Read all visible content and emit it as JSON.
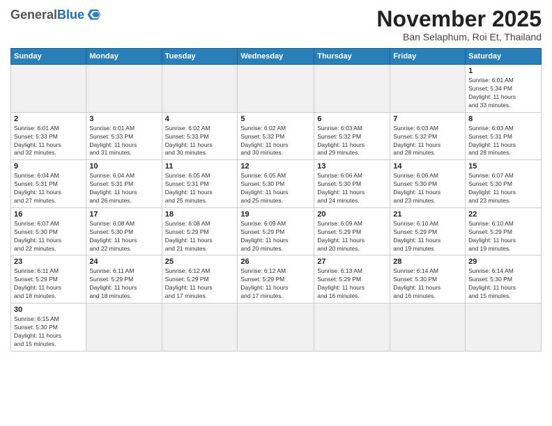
{
  "header": {
    "logo_general": "General",
    "logo_blue": "Blue",
    "month_title": "November 2025",
    "subtitle": "Ban Selaphum, Roi Et, Thailand"
  },
  "weekdays": [
    "Sunday",
    "Monday",
    "Tuesday",
    "Wednesday",
    "Thursday",
    "Friday",
    "Saturday"
  ],
  "days": [
    {
      "num": "",
      "info": ""
    },
    {
      "num": "",
      "info": ""
    },
    {
      "num": "",
      "info": ""
    },
    {
      "num": "",
      "info": ""
    },
    {
      "num": "",
      "info": ""
    },
    {
      "num": "",
      "info": ""
    },
    {
      "num": "1",
      "info": "Sunrise: 6:01 AM\nSunset: 5:34 PM\nDaylight: 11 hours\nand 33 minutes."
    },
    {
      "num": "2",
      "info": "Sunrise: 6:01 AM\nSunset: 5:33 PM\nDaylight: 11 hours\nand 32 minutes."
    },
    {
      "num": "3",
      "info": "Sunrise: 6:01 AM\nSunset: 5:33 PM\nDaylight: 11 hours\nand 31 minutes."
    },
    {
      "num": "4",
      "info": "Sunrise: 6:02 AM\nSunset: 5:33 PM\nDaylight: 11 hours\nand 30 minutes."
    },
    {
      "num": "5",
      "info": "Sunrise: 6:02 AM\nSunset: 5:32 PM\nDaylight: 11 hours\nand 30 minutes."
    },
    {
      "num": "6",
      "info": "Sunrise: 6:03 AM\nSunset: 5:32 PM\nDaylight: 11 hours\nand 29 minutes."
    },
    {
      "num": "7",
      "info": "Sunrise: 6:03 AM\nSunset: 5:32 PM\nDaylight: 11 hours\nand 28 minutes."
    },
    {
      "num": "8",
      "info": "Sunrise: 6:03 AM\nSunset: 5:31 PM\nDaylight: 11 hours\nand 28 minutes."
    },
    {
      "num": "9",
      "info": "Sunrise: 6:04 AM\nSunset: 5:31 PM\nDaylight: 11 hours\nand 27 minutes."
    },
    {
      "num": "10",
      "info": "Sunrise: 6:04 AM\nSunset: 5:31 PM\nDaylight: 11 hours\nand 26 minutes."
    },
    {
      "num": "11",
      "info": "Sunrise: 6:05 AM\nSunset: 5:31 PM\nDaylight: 11 hours\nand 25 minutes."
    },
    {
      "num": "12",
      "info": "Sunrise: 6:05 AM\nSunset: 5:30 PM\nDaylight: 11 hours\nand 25 minutes."
    },
    {
      "num": "13",
      "info": "Sunrise: 6:06 AM\nSunset: 5:30 PM\nDaylight: 11 hours\nand 24 minutes."
    },
    {
      "num": "14",
      "info": "Sunrise: 6:06 AM\nSunset: 5:30 PM\nDaylight: 11 hours\nand 23 minutes."
    },
    {
      "num": "15",
      "info": "Sunrise: 6:07 AM\nSunset: 5:30 PM\nDaylight: 11 hours\nand 23 minutes."
    },
    {
      "num": "16",
      "info": "Sunrise: 6:07 AM\nSunset: 5:30 PM\nDaylight: 11 hours\nand 22 minutes."
    },
    {
      "num": "17",
      "info": "Sunrise: 6:08 AM\nSunset: 5:30 PM\nDaylight: 11 hours\nand 22 minutes."
    },
    {
      "num": "18",
      "info": "Sunrise: 6:08 AM\nSunset: 5:29 PM\nDaylight: 11 hours\nand 21 minutes."
    },
    {
      "num": "19",
      "info": "Sunrise: 6:09 AM\nSunset: 5:29 PM\nDaylight: 11 hours\nand 20 minutes."
    },
    {
      "num": "20",
      "info": "Sunrise: 6:09 AM\nSunset: 5:29 PM\nDaylight: 11 hours\nand 20 minutes."
    },
    {
      "num": "21",
      "info": "Sunrise: 6:10 AM\nSunset: 5:29 PM\nDaylight: 11 hours\nand 19 minutes."
    },
    {
      "num": "22",
      "info": "Sunrise: 6:10 AM\nSunset: 5:29 PM\nDaylight: 11 hours\nand 19 minutes."
    },
    {
      "num": "23",
      "info": "Sunrise: 6:11 AM\nSunset: 5:29 PM\nDaylight: 11 hours\nand 18 minutes."
    },
    {
      "num": "24",
      "info": "Sunrise: 6:11 AM\nSunset: 5:29 PM\nDaylight: 11 hours\nand 18 minutes."
    },
    {
      "num": "25",
      "info": "Sunrise: 6:12 AM\nSunset: 5:29 PM\nDaylight: 11 hours\nand 17 minutes."
    },
    {
      "num": "26",
      "info": "Sunrise: 6:12 AM\nSunset: 5:29 PM\nDaylight: 11 hours\nand 17 minutes."
    },
    {
      "num": "27",
      "info": "Sunrise: 6:13 AM\nSunset: 5:29 PM\nDaylight: 11 hours\nand 16 minutes."
    },
    {
      "num": "28",
      "info": "Sunrise: 6:14 AM\nSunset: 5:30 PM\nDaylight: 11 hours\nand 16 minutes."
    },
    {
      "num": "29",
      "info": "Sunrise: 6:14 AM\nSunset: 5:30 PM\nDaylight: 11 hours\nand 15 minutes."
    },
    {
      "num": "30",
      "info": "Sunrise: 6:15 AM\nSunset: 5:30 PM\nDaylight: 11 hours\nand 15 minutes."
    }
  ]
}
